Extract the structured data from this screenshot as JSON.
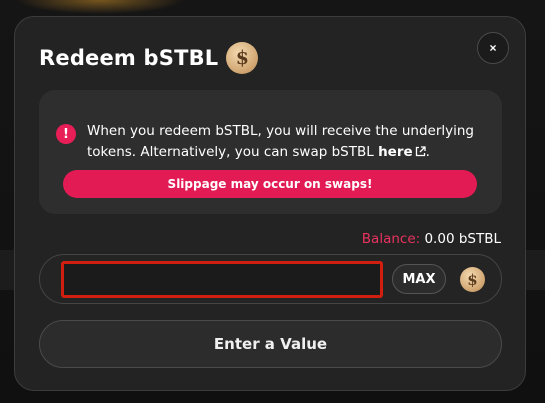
{
  "modal": {
    "title": "Redeem bSTBL",
    "close_label": "×",
    "coin_symbol": "$"
  },
  "info": {
    "warning_icon": "!",
    "text_before_link": "When you redeem bSTBL, you will receive the underlying tokens. Alternatively, you can swap bSTBL ",
    "link_text": "here",
    "text_after_link": ".",
    "slippage_notice": "Slippage may occur on swaps!"
  },
  "balance": {
    "label": "Balance:",
    "value": "0.00 bSTBL"
  },
  "amount_input": {
    "value": "",
    "placeholder": ""
  },
  "max_label": "MAX",
  "submit_label": "Enter a Value",
  "colors": {
    "accent": "#e31b54",
    "modal_bg": "#232323",
    "info_bg": "#2e2e2e",
    "input_focus_border": "#d11f0f",
    "coin": "#d5ab78"
  },
  "icons": {
    "coin": "dollar-coin-icon",
    "warning": "exclamation-circle-icon",
    "external": "external-link-icon",
    "close": "close-icon"
  }
}
